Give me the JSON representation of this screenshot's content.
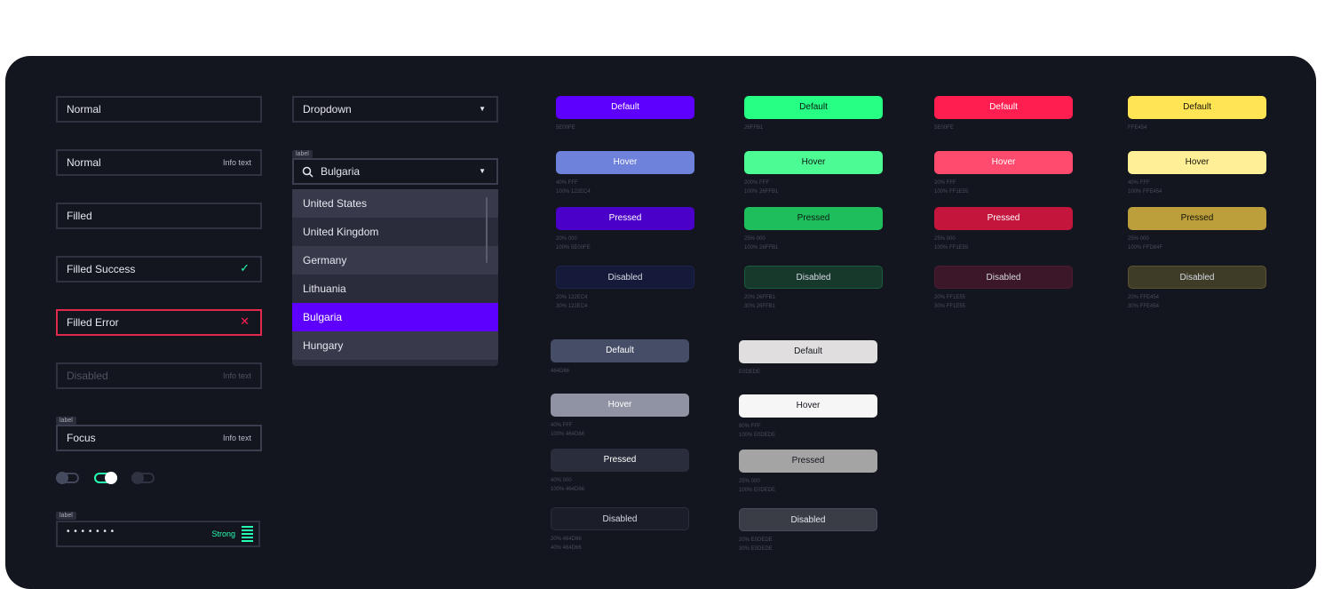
{
  "inputs": {
    "normal": "Normal",
    "normal_info": "Normal",
    "info_text": "Info text",
    "filled": "Filled",
    "filled_success": "Filled Success",
    "filled_error": "Filled Error",
    "disabled": "Disabled",
    "focus": "Focus",
    "small_label": "label",
    "password_dots": "• • • • • • •",
    "password_strength": "Strong"
  },
  "dropdown": {
    "placeholder": "Dropdown",
    "search_label": "label",
    "search_value": "Bulgaria",
    "options": [
      "United States",
      "United Kingdom",
      "Germany",
      "Lithuania",
      "Bulgaria",
      "Hungary"
    ],
    "selected": "Bulgaria"
  },
  "toggles": [
    {
      "state": "off"
    },
    {
      "state": "on"
    },
    {
      "state": "disabled"
    }
  ],
  "colors": {
    "purple": "#5E00FE",
    "green": "#26FFB1",
    "red": "#FF1E55",
    "yellow": "#FFE454",
    "slate": "#464D66",
    "light": "#E0DEDE"
  },
  "button_groups": [
    {
      "default": {
        "label": "Default",
        "caption": "5E00FE"
      },
      "hover": {
        "label": "Hover",
        "caption": [
          "40% FFF",
          "100% 122EC4"
        ]
      },
      "pressed": {
        "label": "Pressed",
        "caption": [
          "20% 000",
          "100% 5E00FE"
        ]
      },
      "disabled": {
        "label": "Disabled",
        "caption": [
          "20% 122EC4",
          "30% 122EC4"
        ]
      }
    },
    {
      "default": {
        "label": "Default",
        "caption": "26FFB1"
      },
      "hover": {
        "label": "Hover",
        "caption": [
          "200% FFF",
          "100% 26FFB1"
        ]
      },
      "pressed": {
        "label": "Pressed",
        "caption": [
          "25% 000",
          "100% 26FFB1"
        ]
      },
      "disabled": {
        "label": "Disabled",
        "caption": [
          "20% 26FFB1",
          "30% 26FFB1"
        ]
      }
    },
    {
      "default": {
        "label": "Default",
        "caption": "5E00FE"
      },
      "hover": {
        "label": "Hover",
        "caption": [
          "20% FFF",
          "100% FF1E55"
        ]
      },
      "pressed": {
        "label": "Pressed",
        "caption": [
          "25% 000",
          "100% FF1E55"
        ]
      },
      "disabled": {
        "label": "Disabled",
        "caption": [
          "20% FF1E55",
          "30% FF1E55"
        ]
      }
    },
    {
      "default": {
        "label": "Default",
        "caption": "FFE454"
      },
      "hover": {
        "label": "Hover",
        "caption": [
          "40% FFF",
          "100% FFE454"
        ]
      },
      "pressed": {
        "label": "Pressed",
        "caption": [
          "25% 000",
          "100% FFD84F"
        ]
      },
      "disabled": {
        "label": "Disabled",
        "caption": [
          "20% FFE454",
          "30% FFE454"
        ]
      }
    },
    {
      "default": {
        "label": "Default",
        "caption": "464D66"
      },
      "hover": {
        "label": "Hover",
        "caption": [
          "40% FFF",
          "100% 464D66"
        ]
      },
      "pressed": {
        "label": "Pressed",
        "caption": [
          "40% 000",
          "100% 464D66"
        ]
      },
      "disabled": {
        "label": "Disabled",
        "caption": [
          "20% 464D66",
          "40% 464D66"
        ]
      }
    },
    {
      "default": {
        "label": "Default",
        "caption": "E0DEDE"
      },
      "hover": {
        "label": "Hover",
        "caption": [
          "80% FFF",
          "100% E0DEDE"
        ]
      },
      "pressed": {
        "label": "Pressed",
        "caption": [
          "25% 000",
          "100% E0DEDE"
        ]
      },
      "disabled": {
        "label": "Disabled",
        "caption": [
          "20% E0DEDE",
          "30% E0DEDE"
        ]
      }
    }
  ]
}
